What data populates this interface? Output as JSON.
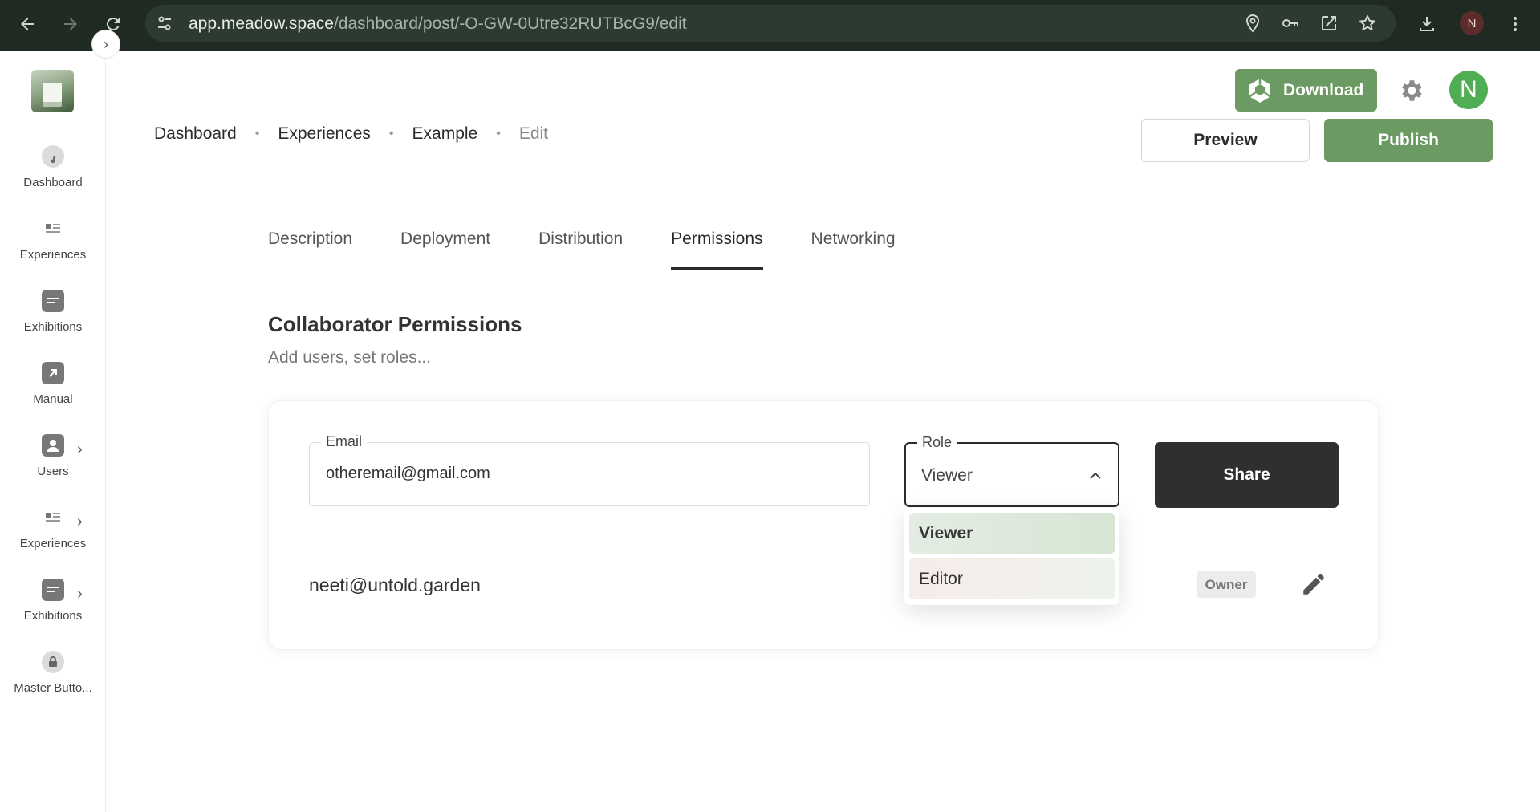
{
  "browser": {
    "url_host": "app.meadow.space",
    "url_path": "/dashboard/post/-O-GW-0Utre32RUTBcG9/edit",
    "profile_initial": "N",
    "icons": [
      "back-icon",
      "forward-icon",
      "reload-icon",
      "site-settings-icon",
      "location-icon",
      "key-icon",
      "open-in-app-icon",
      "star-icon",
      "download-icon",
      "more-icon"
    ]
  },
  "sidebar": {
    "items": [
      {
        "label": "Dashboard",
        "icon": "gauge-icon"
      },
      {
        "label": "Experiences",
        "icon": "list-icon"
      },
      {
        "label": "Exhibitions",
        "icon": "calendar-icon"
      },
      {
        "label": "Manual",
        "icon": "external-link-icon"
      },
      {
        "label": "Users",
        "icon": "user-icon"
      },
      {
        "label": "Experiences",
        "icon": "list-icon"
      },
      {
        "label": "Exhibitions",
        "icon": "calendar-icon"
      },
      {
        "label": "Master Butto...",
        "icon": "lock-icon"
      }
    ]
  },
  "header": {
    "download_label": "Download",
    "avatar_initial": "N",
    "preview_label": "Preview",
    "publish_label": "Publish"
  },
  "breadcrumb": [
    "Dashboard",
    "Experiences",
    "Example",
    "Edit"
  ],
  "tabs": [
    "Description",
    "Deployment",
    "Distribution",
    "Permissions",
    "Networking"
  ],
  "active_tab": "Permissions",
  "section": {
    "title": "Collaborator Permissions",
    "subtitle": "Add users, set roles..."
  },
  "form": {
    "email_label": "Email",
    "email_value": "otheremail@gmail.com",
    "role_label": "Role",
    "role_value": "Viewer",
    "share_label": "Share"
  },
  "dropdown": {
    "options": [
      "Viewer",
      "Editor"
    ],
    "selected": "Viewer"
  },
  "members": [
    {
      "email": "neeti@untold.garden",
      "role": "Owner"
    }
  ],
  "colors": {
    "brand_green": "#6b9a62",
    "avatar_green": "#4fae54",
    "share_dark": "#2f2f2f"
  }
}
